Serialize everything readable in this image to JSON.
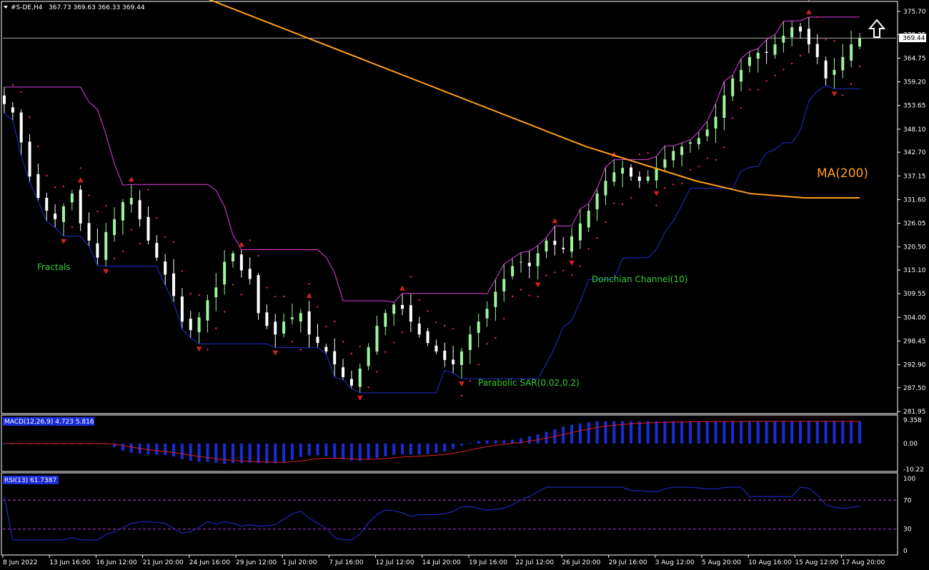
{
  "header": {
    "symbol": "#S-DE,H4",
    "ohlc": "367.73 369.63 366.33 369.44"
  },
  "colors": {
    "background": "#000000",
    "bull_candle": "#9ef59e",
    "bear_candle": "#ffffff",
    "ma200": "#ff9f1c",
    "donchian_upper": "#e040e0",
    "donchian_lower": "#2030d0",
    "sar": "#ff3050",
    "fractal": "#d02020",
    "macd_hist": "#1a2cd8",
    "macd_signal": "#e02020",
    "rsi_line": "#2030e0",
    "rsi_level": "#b040d0",
    "annotation_green": "#30d030"
  },
  "annotations": {
    "fractals": "Fractals",
    "donchian": "Donchian Channel(10)",
    "sar": "Parabolic SAR(0.02,0.2)",
    "ma": "MA(200)"
  },
  "arrow_icon": "up-arrow-icon",
  "main_chart": {
    "current_price": "369.44",
    "y_ticks": [
      "375.70",
      "370.25",
      "364.75",
      "359.20",
      "353.65",
      "348.10",
      "342.70",
      "337.15",
      "331.60",
      "326.05",
      "320.50",
      "315.10",
      "309.55",
      "304.00",
      "298.45",
      "292.90",
      "287.50",
      "281.95"
    ]
  },
  "macd_panel": {
    "title": "MACD(12,26,9) 4.723 5.816",
    "y_ticks": [
      "9.358",
      "0.00",
      "-10.22"
    ]
  },
  "rsi_panel": {
    "title": "RSI(13) 61.7387",
    "y_ticks": [
      "100",
      "70",
      "30",
      "0"
    ]
  },
  "x_labels": [
    "8 Jun 2022",
    "13 Jun 16:00",
    "16 Jun 12:00",
    "21 Jun 20:00",
    "24 Jun 16:00",
    "29 Jun 12:00",
    "1 Jul 20:00",
    "7 Jul 16:00",
    "12 Jul 12:00",
    "14 Jul 20:00",
    "19 Jul 16:00",
    "22 Jul 12:00",
    "26 Jul 20:00",
    "29 Jul 16:00",
    "3 Aug 12:00",
    "5 Aug 20:00",
    "10 Aug 16:00",
    "15 Aug 12:00",
    "17 Aug 20:00"
  ],
  "chart_data": {
    "type": "candlestick",
    "price_series": [
      {
        "name": "Close",
        "values": [
          354,
          352,
          345,
          337,
          332,
          329,
          327,
          330,
          333,
          326,
          322,
          318,
          324,
          327,
          331,
          332,
          327,
          322,
          318,
          314,
          309,
          303,
          301,
          304,
          308,
          311,
          317,
          319,
          315,
          313,
          305,
          302,
          300,
          303,
          304,
          305,
          300,
          298,
          296,
          293,
          290,
          288,
          292,
          297,
          302,
          305,
          307,
          306,
          303,
          300,
          298,
          296,
          294,
          293,
          296,
          300,
          303,
          306,
          310,
          313,
          316,
          317,
          316,
          319,
          322,
          321,
          320,
          323,
          326,
          329,
          333,
          336,
          338,
          339,
          337,
          336,
          337,
          339,
          341,
          343,
          344,
          345,
          346,
          348,
          351,
          356,
          360,
          362,
          365,
          366,
          366,
          368,
          370,
          372,
          371,
          368,
          365,
          360,
          362,
          365,
          368,
          369.44
        ]
      }
    ],
    "ma200": {
      "name": "MA(200)",
      "values": [
        379,
        374,
        369,
        364,
        359,
        354,
        349,
        344,
        340,
        336,
        333,
        332,
        332
      ]
    },
    "ylim": [
      281.95,
      375.7
    ],
    "macd": {
      "title": "MACD(12,26,9)",
      "main": 4.723,
      "signal": 5.816,
      "ylim": [
        -10.22,
        9.358
      ]
    },
    "rsi": {
      "title": "RSI(13)",
      "value": 61.7387,
      "levels": [
        30,
        70
      ],
      "ylim": [
        0,
        100
      ]
    }
  }
}
